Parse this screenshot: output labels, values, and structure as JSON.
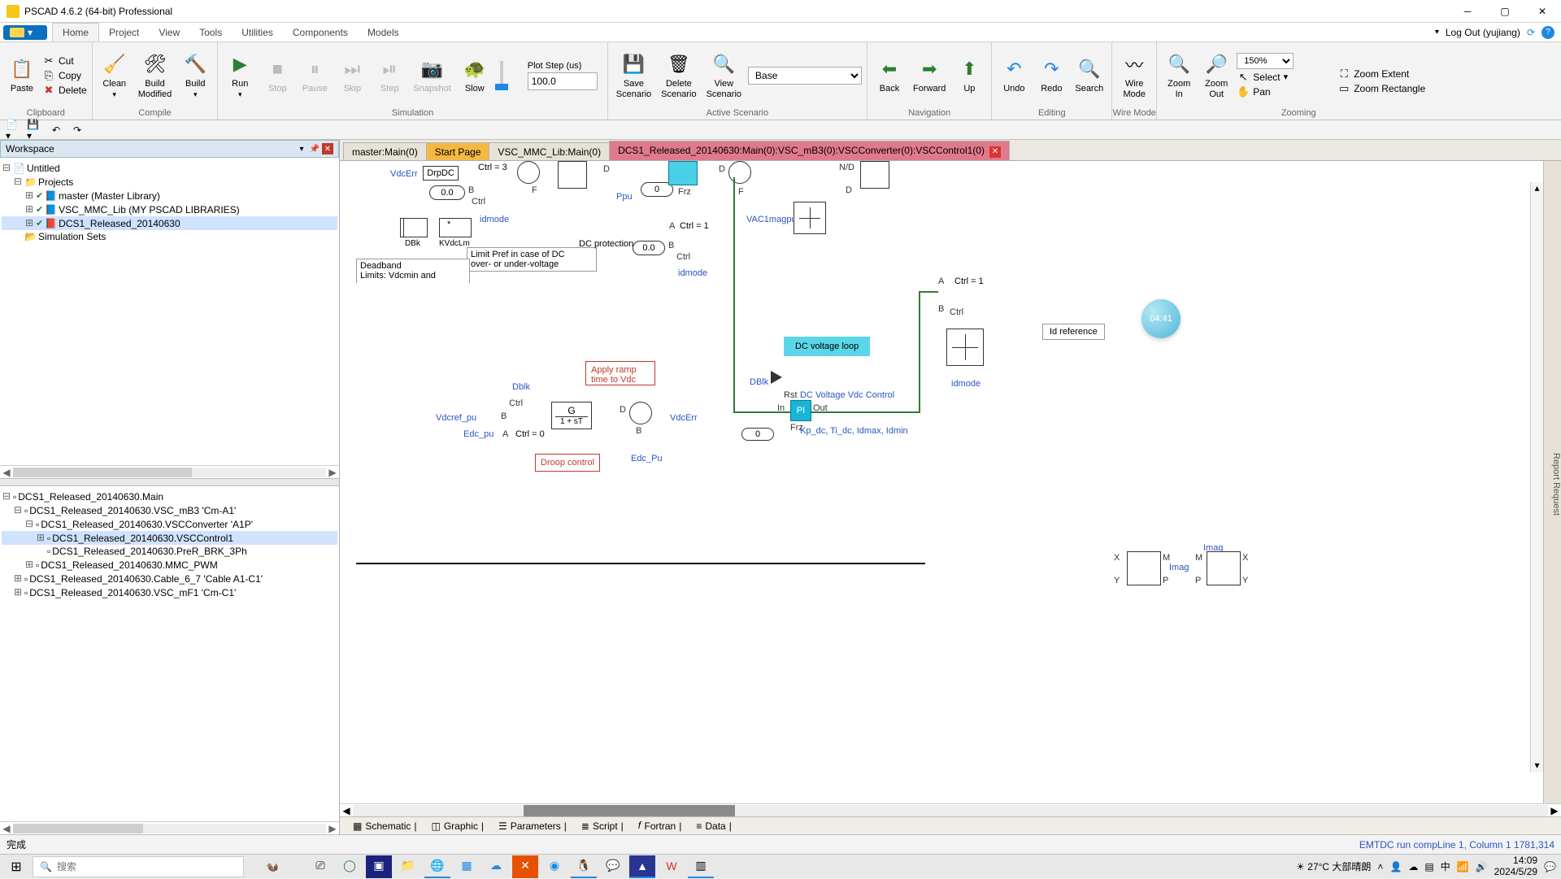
{
  "app": {
    "title": "PSCAD 4.6.2 (64-bit) Professional"
  },
  "menu": {
    "tabs": [
      "Home",
      "Project",
      "View",
      "Tools",
      "Utilities",
      "Components",
      "Models"
    ],
    "logout": "Log Out (yujiang)"
  },
  "ribbon": {
    "clipboard": {
      "label": "Clipboard",
      "paste": "Paste",
      "cut": "Cut",
      "copy": "Copy",
      "delete": "Delete"
    },
    "compile": {
      "label": "Compile",
      "clean": "Clean",
      "buildmod": "Build\nModified",
      "build": "Build"
    },
    "simulation": {
      "label": "Simulation",
      "run": "Run",
      "stop": "Stop",
      "pause": "Pause",
      "skip": "Skip",
      "step": "Step",
      "snapshot": "Snapshot",
      "slow": "Slow",
      "plotstep_label": "Plot Step (us)",
      "plotstep_value": "100.0"
    },
    "scenario": {
      "label": "Active Scenario",
      "save": "Save\nScenario",
      "delete": "Delete\nScenario",
      "view": "View\nScenario",
      "selected": "Base"
    },
    "nav": {
      "label": "Navigation",
      "back": "Back",
      "forward": "Forward",
      "up": "Up"
    },
    "edit": {
      "label": "Editing",
      "undo": "Undo",
      "redo": "Redo",
      "search": "Search"
    },
    "wire": {
      "label": "Wire Mode",
      "wiremode": "Wire\nMode"
    },
    "zoom": {
      "label": "Zooming",
      "zin": "Zoom\nIn",
      "zout": "Zoom\nOut",
      "select": "Select",
      "pan": "Pan",
      "extent": "Zoom Extent",
      "rect": "Zoom Rectangle",
      "pct": "150%"
    }
  },
  "ws": {
    "header": "Workspace",
    "untitled": "Untitled",
    "projects": "Projects",
    "items": [
      "master (Master Library)",
      "VSC_MMC_Lib (MY PSCAD LIBRARIES)",
      "DCS1_Released_20140630"
    ],
    "simsets": "Simulation Sets"
  },
  "nav2": {
    "root": "DCS1_Released_20140630.Main",
    "i0": "DCS1_Released_20140630.VSC_mB3 'Cm-A1'",
    "i1": "DCS1_Released_20140630.VSCConverter 'A1P'",
    "i2": "DCS1_Released_20140630.VSCControl1",
    "i3": "DCS1_Released_20140630.PreR_BRK_3Ph",
    "i4": "DCS1_Released_20140630.MMC_PWM",
    "i5": "DCS1_Released_20140630.Cable_6_7 'Cable A1-C1'",
    "i6": "DCS1_Released_20140630.VSC_mF1 'Cm-C1'"
  },
  "tabs": {
    "t0": "master:Main(0)",
    "t1": "Start Page",
    "t2": "VSC_MMC_Lib:Main(0)",
    "t3": "DCS1_Released_20140630:Main(0):VSC_mB3(0):VSCConverter(0):VSCControl1(0)"
  },
  "canvas": {
    "vdcerr": "VdcErr",
    "drpdc": "DrpDC",
    "ctrl3": "Ctrl  =   3",
    "zero1": "0.0",
    "dbk": "DBk",
    "kvdclm": "KVdcLm",
    "idmode": "idmode",
    "star": "*",
    "limitpref": "Limit Pref in case of DC\nover- or under-voltage",
    "deadband": "Deadband\nLimits: Vdcmin and",
    "dcprot": "DC protection",
    "zero2": "0.0",
    "ctrl_b": "Ctrl",
    "idmode2": "idmode",
    "ppu": "Ppu",
    "zero_mid": "0",
    "nd": "N/D",
    "ab": "A",
    "bb": "B",
    "db": "D",
    "fb": "F",
    "frz": "Frz",
    "vac1": "VAC1magpu",
    "ctrl1": "Ctrl  =   1",
    "ctrl1b": "Ctrl  =   1",
    "idref": "Id reference",
    "idmode3": "idmode",
    "dcvloop": "DC voltage loop",
    "applyramp": "Apply ramp\ntime to Vdc set",
    "dblk2": "Dblk",
    "ctrlc": "Ctrl",
    "vdcref": "Vdcref_pu",
    "edc": "Edc_pu",
    "ctrl0": "Ctrl  =   0",
    "g": "G",
    "tf": "1 + sT",
    "vdcerr2": "VdcErr",
    "edcpu": "Edc_Pu",
    "droop": "Droop control",
    "dblk3": "DBlk",
    "rst": "Rst",
    "in": "In",
    "out": "Out",
    "pi": "PI",
    "frz2": "Frz",
    "zero3": "0",
    "dcvctrl": "DC Voltage Vdc Control",
    "kp": "Kp_dc, Ti_dc, Idmax, Idmin",
    "imag": "Imag",
    "imag2": "Imag",
    "xm": "X",
    "ym": "Y",
    "mm": "M",
    "pm": "P"
  },
  "bottomtabs": {
    "schem": "Schematic",
    "graphic": "Graphic",
    "params": "Parameters",
    "script": "Script",
    "fortran": "Fortran",
    "data": "Data"
  },
  "rightgutter": "Report Request",
  "status": {
    "left": "完成",
    "right": "EMTDC run compLine 1, Column 1  1781,314"
  },
  "badge": "04:41",
  "taskbar": {
    "search_placeholder": "搜索",
    "weather": "27°C 大部晴朗",
    "time": "14:09",
    "date": "2024/5/29"
  }
}
